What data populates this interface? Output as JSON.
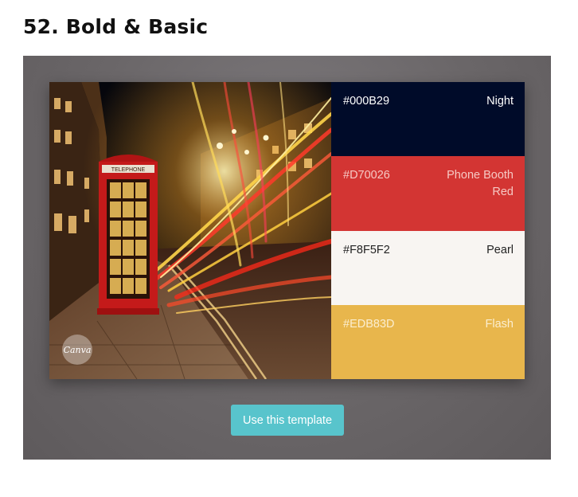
{
  "page": {
    "title": "52. Bold & Basic"
  },
  "card": {
    "badge_label": "Canva",
    "sign_text": "TELEPHONE",
    "swatches": [
      {
        "hex": "#000B29",
        "name": "Night",
        "bg": "#000B29",
        "text_color": "#ffffff"
      },
      {
        "hex": "#D70026",
        "name": "Phone Booth Red",
        "bg": "#D33533",
        "text_color": "#f6c9c4"
      },
      {
        "hex": "#F8F5F2",
        "name": "Pearl",
        "bg": "#F8F5F2",
        "text_color": "#222222"
      },
      {
        "hex": "#EDB83D",
        "name": "Flash",
        "bg": "#E8B64C",
        "text_color": "#fbeed0"
      }
    ]
  },
  "actions": {
    "use_template_label": "Use this template"
  },
  "colors": {
    "button": "#58C4CC",
    "panel": "#6F6B6D"
  }
}
